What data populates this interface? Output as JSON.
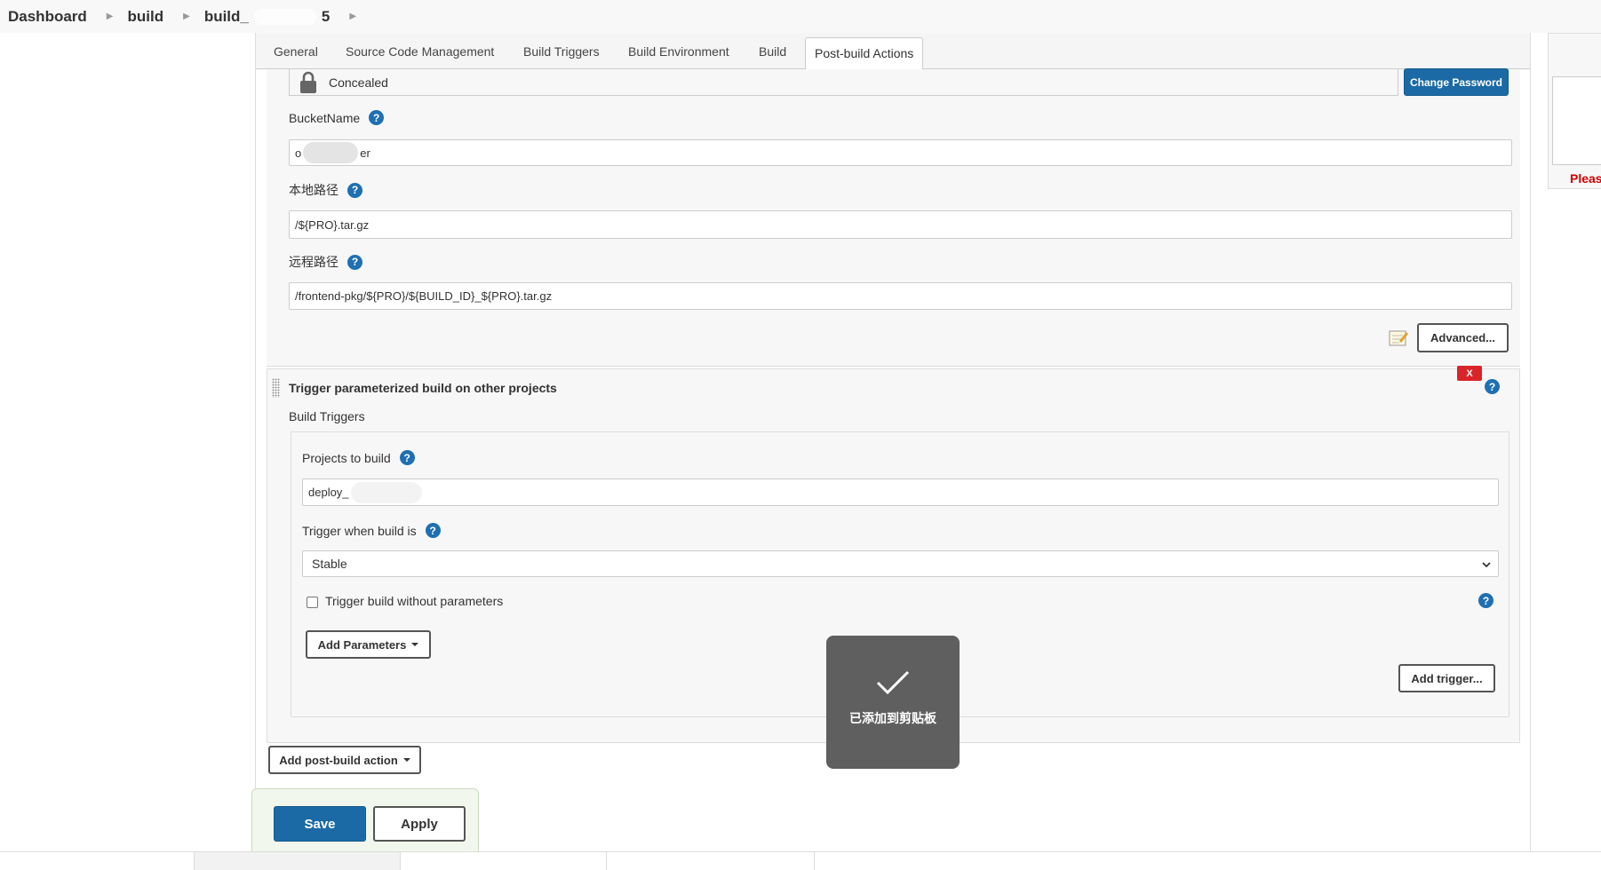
{
  "breadcrumb": {
    "items": [
      "Dashboard",
      "build",
      "build_",
      "5"
    ]
  },
  "tabs": [
    {
      "label": "General"
    },
    {
      "label": "Source Code Management"
    },
    {
      "label": "Build Triggers"
    },
    {
      "label": "Build Environment"
    },
    {
      "label": "Build"
    },
    {
      "label": "Post-build Actions"
    }
  ],
  "password": {
    "value": "Concealed",
    "change_button": "Change Password"
  },
  "bucket": {
    "label": "BucketName",
    "value_start": "o",
    "value_end": "er"
  },
  "local_path": {
    "label": "本地路径",
    "value": "/${PRO}.tar.gz"
  },
  "remote_path": {
    "label": "远程路径",
    "value": "/frontend-pkg/${PRO}/${BUILD_ID}_${PRO}.tar.gz"
  },
  "advanced_button": "Advanced...",
  "trigger_section": {
    "title": "Trigger parameterized build on other projects",
    "delete_label": "X",
    "subheading": "Build Triggers",
    "projects_label": "Projects to build",
    "projects_value": "deploy_",
    "trigger_when_label": "Trigger when build is",
    "trigger_when_value": "Stable",
    "checkbox_label": "Trigger build without parameters",
    "add_parameters": "Add Parameters",
    "add_trigger": "Add trigger..."
  },
  "add_post_build": "Add post-build action",
  "save_button": "Save",
  "apply_button": "Apply",
  "toast": {
    "message": "已添加到剪贴板"
  },
  "right_widget": {
    "text": "Pleas"
  },
  "help_glyph": "?",
  "colors": {
    "primary": "#1b6aa5",
    "danger": "#d9242a",
    "help": "#1f6fb2"
  }
}
